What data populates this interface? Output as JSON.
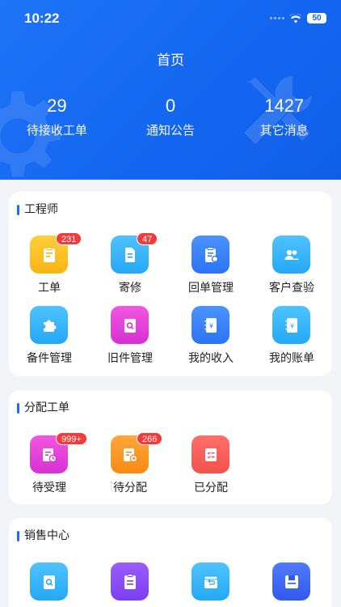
{
  "status_bar": {
    "time": "10:22",
    "battery": "50"
  },
  "header": {
    "title": "首页",
    "stats": [
      {
        "value": "29",
        "label": "待接收工单"
      },
      {
        "value": "0",
        "label": "通知公告"
      },
      {
        "value": "1427",
        "label": "其它消息"
      }
    ]
  },
  "sections": {
    "engineer": {
      "title": "工程师",
      "items": [
        {
          "label": "工单",
          "icon": "clipboard-edit-icon",
          "color": "#f7b515",
          "badge": "231"
        },
        {
          "label": "寄修",
          "icon": "document-icon",
          "color": "#24a8f5",
          "badge": "47"
        },
        {
          "label": "回单管理",
          "icon": "clipboard-list-icon",
          "color": "#2c74f4"
        },
        {
          "label": "客户查验",
          "icon": "users-icon",
          "color": "#24a8f5"
        },
        {
          "label": "备件管理",
          "icon": "puzzle-icon",
          "color": "#24a8f5"
        },
        {
          "label": "旧件管理",
          "icon": "search-doc-icon",
          "color": "#d630d2"
        },
        {
          "label": "我的收入",
          "icon": "income-book-icon",
          "color": "#2c74f4"
        },
        {
          "label": "我的账单",
          "icon": "bill-book-icon",
          "color": "#24a8f5"
        }
      ]
    },
    "dispatch": {
      "title": "分配工单",
      "items": [
        {
          "label": "待受理",
          "icon": "pending-clock-icon",
          "color": "#d630d2",
          "badge": "999+"
        },
        {
          "label": "待分配",
          "icon": "assign-icon",
          "color": "#f88a12",
          "badge": "266"
        },
        {
          "label": "已分配",
          "icon": "checklist-icon",
          "color": "#f4524d"
        }
      ]
    },
    "sales": {
      "title": "销售中心",
      "items": [
        {
          "icon": "search-doc-icon",
          "color": "#24a8f5"
        },
        {
          "icon": "clipboard-icon",
          "color": "#7c3ff1"
        },
        {
          "icon": "return-box-icon",
          "color": "#24a8f5"
        },
        {
          "icon": "save-disk-icon",
          "color": "#3258ee"
        }
      ]
    }
  }
}
